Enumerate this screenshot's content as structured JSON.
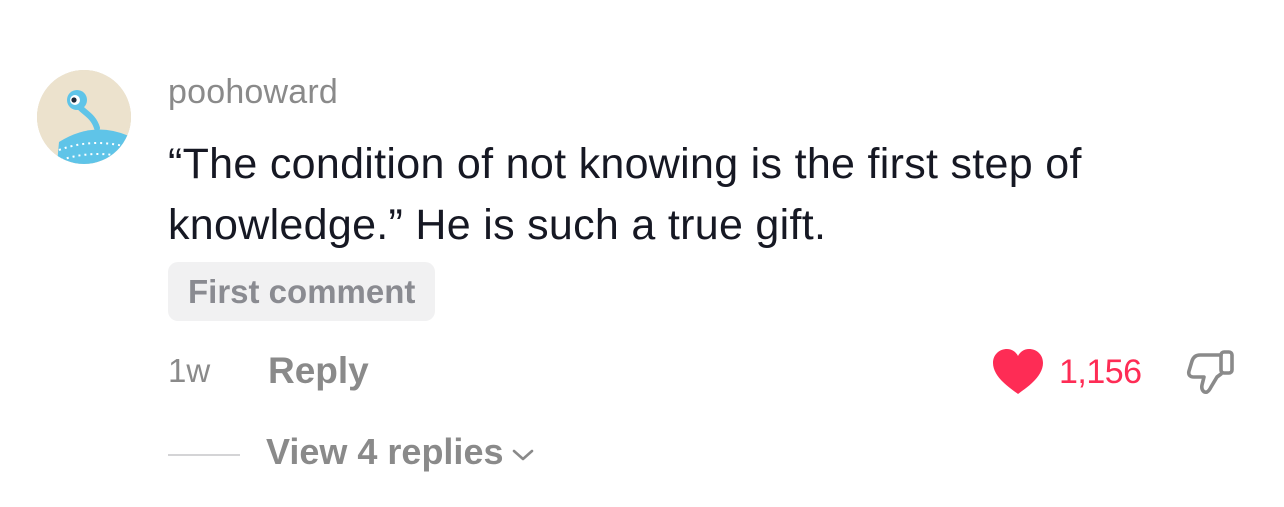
{
  "comment": {
    "avatar_icon": "alien-creature-avatar-icon",
    "username": "poohoward",
    "text": "“The condition of not knowing is the first step of knowledge.” He is such a true gift.",
    "badge": "First comment",
    "timestamp": "1w",
    "reply_label": "Reply",
    "likes": {
      "count": "1,156",
      "icon": "heart-icon",
      "liked": true,
      "color": "#fe2c55"
    },
    "dislike_icon": "thumbs-down-icon",
    "view_replies_label": "View 4 replies",
    "view_replies_icon": "chevron-down-icon"
  }
}
